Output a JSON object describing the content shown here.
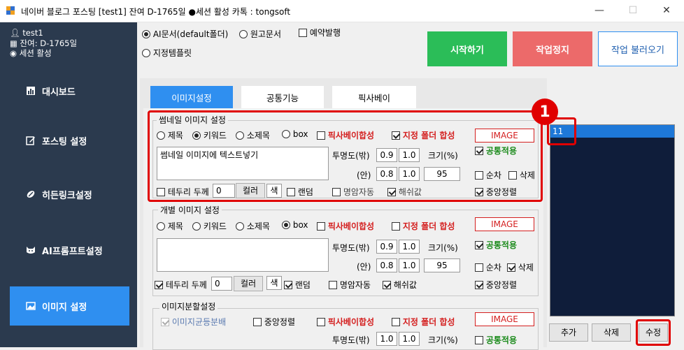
{
  "window": {
    "title": "네이버 블로그 포스팅   [test1]  잔여 D-1765일  ●세션 활성     카톡 : tongsoft",
    "minimize": "—",
    "maximize": "☐",
    "close": "✕"
  },
  "sidebar": {
    "user": "test1",
    "remaining": "잔여: D-1765일",
    "session": "세션 활성",
    "items": [
      {
        "label": "대시보드",
        "icon": "chart-icon"
      },
      {
        "label": "포스팅 설정",
        "icon": "edit-icon"
      },
      {
        "label": "히든링크설정",
        "icon": "link-icon"
      },
      {
        "label": "AI프롬프트설정",
        "icon": "robot-icon"
      },
      {
        "label": "이미지 설정",
        "icon": "image-icon",
        "active": true
      }
    ]
  },
  "top": {
    "mode_ai": "AI문서(default폴더)",
    "mode_draft": "원고문서",
    "schedule": "예약발행",
    "mode_template": "지정템플릿",
    "start": "시작하기",
    "stop": "작업정지",
    "load": "작업 불러오기"
  },
  "tabs": [
    "이미지설정",
    "공통기능",
    "픽사베이"
  ],
  "thumbnail": {
    "title": "썸네일 이미지 설정",
    "r_title": "제목",
    "r_keyword": "키워드",
    "r_subtitle": "소제목",
    "r_box": "box",
    "pixabay": "픽사베이합성",
    "folder": "지정 폴더 합성",
    "image_btn": "IMAGE",
    "common": "공통적용",
    "text": "썸네일 이미지에 텍스트넣기",
    "opacity_out": "투명도(밖)",
    "opacity_in": "(안)",
    "out_a": "0.9",
    "out_b": "1.0",
    "in_a": "0.8",
    "in_b": "1.0",
    "size_label": "크기(%)",
    "size": "95",
    "order": "순차",
    "delete": "삭제",
    "border": "테두리 두께",
    "border_val": "0",
    "color": "컬러",
    "color_swatch": "색",
    "random": "랜덤",
    "contrast": "명암자동",
    "hash": "해쉬값",
    "center": "중앙정렬"
  },
  "individual": {
    "title": "개별 이미지 설정",
    "r_title": "제목",
    "r_keyword": "키워드",
    "r_subtitle": "소제목",
    "r_box": "box",
    "pixabay": "픽사베이합성",
    "folder": "지정 폴더 합성",
    "image_btn": "IMAGE",
    "common": "공통적용",
    "opacity_out": "투명도(밖)",
    "opacity_in": "(안)",
    "out_a": "0.9",
    "out_b": "1.0",
    "in_a": "0.8",
    "in_b": "1.0",
    "size_label": "크기(%)",
    "size": "95",
    "order": "순차",
    "delete": "삭제",
    "border": "테두리 두께",
    "border_val": "0",
    "color": "컬러",
    "color_swatch": "색",
    "random": "랜덤",
    "contrast": "명암자동",
    "hash": "해쉬값",
    "center": "중앙정렬"
  },
  "split": {
    "title": "이미지분할설정",
    "even": "이미지균등분배",
    "center": "중앙정렬",
    "pixabay": "픽사베이합성",
    "folder": "지정 폴더 합성",
    "image_btn": "IMAGE",
    "common": "공통적용",
    "opacity_out": "투명도(밖)",
    "out_a": "1.0",
    "out_b": "1.0",
    "size_label": "크기(%)"
  },
  "list": {
    "items": [
      "11"
    ],
    "add": "추가",
    "delete": "삭제",
    "edit": "수정"
  },
  "annotation": {
    "badge": "1"
  },
  "colors": {
    "sidebar": "#2b3a4e",
    "active": "#2f8ff0",
    "start": "#2bbd58",
    "stop": "#ec6a6a",
    "highlight": "#e00000"
  }
}
